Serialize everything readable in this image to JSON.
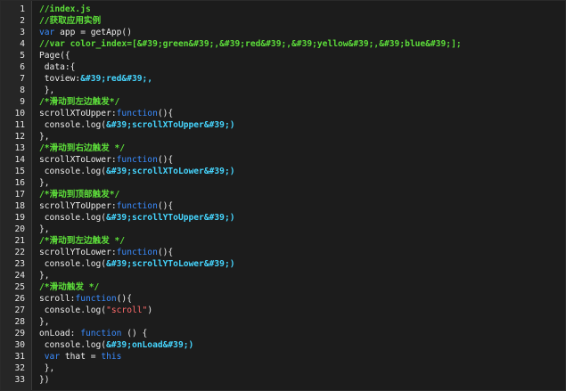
{
  "editor": {
    "lines": [
      {
        "n": "1",
        "segs": [
          {
            "t": "//index.js",
            "k": "cm"
          }
        ]
      },
      {
        "n": "2",
        "segs": [
          {
            "t": "//获取应用实例",
            "k": "cm"
          }
        ]
      },
      {
        "n": "3",
        "segs": [
          {
            "t": "var",
            "k": "kw"
          },
          {
            "t": " app = getApp()",
            "k": "plain"
          }
        ]
      },
      {
        "n": "4",
        "segs": [
          {
            "t": "//var color_index=[&#39;green&#39;,&#39;red&#39;,&#39;yellow&#39;,&#39;blue&#39;];",
            "k": "cm"
          }
        ]
      },
      {
        "n": "5",
        "segs": [
          {
            "t": "Page({",
            "k": "plain"
          }
        ]
      },
      {
        "n": "6",
        "segs": [
          {
            "t": " data:{",
            "k": "plain"
          }
        ]
      },
      {
        "n": "7",
        "segs": [
          {
            "t": " toview:",
            "k": "plain"
          },
          {
            "t": "&#39;red&#39;,",
            "k": "str"
          }
        ]
      },
      {
        "n": "8",
        "segs": [
          {
            "t": " },",
            "k": "plain"
          }
        ]
      },
      {
        "n": "9",
        "segs": [
          {
            "t": "/*滑动到左边触发*/",
            "k": "cm"
          }
        ]
      },
      {
        "n": "10",
        "segs": [
          {
            "t": "scrollXToUpper:",
            "k": "plain"
          },
          {
            "t": "function",
            "k": "kw"
          },
          {
            "t": "(){",
            "k": "plain"
          }
        ]
      },
      {
        "n": "11",
        "segs": [
          {
            "t": " console.log(",
            "k": "plain"
          },
          {
            "t": "&#39;scrollXToUpper&#39;)",
            "k": "str"
          }
        ]
      },
      {
        "n": "12",
        "segs": [
          {
            "t": "},",
            "k": "plain"
          }
        ]
      },
      {
        "n": "13",
        "segs": [
          {
            "t": "/*滑动到右边触发 */",
            "k": "cm"
          }
        ]
      },
      {
        "n": "14",
        "segs": [
          {
            "t": "scrollXToLower:",
            "k": "plain"
          },
          {
            "t": "function",
            "k": "kw"
          },
          {
            "t": "(){",
            "k": "plain"
          }
        ]
      },
      {
        "n": "15",
        "segs": [
          {
            "t": " console.log(",
            "k": "plain"
          },
          {
            "t": "&#39;scrollXToLower&#39;)",
            "k": "str"
          }
        ]
      },
      {
        "n": "16",
        "segs": [
          {
            "t": "},",
            "k": "plain"
          }
        ]
      },
      {
        "n": "17",
        "segs": [
          {
            "t": "/*滑动到顶部触发*/",
            "k": "cm"
          }
        ]
      },
      {
        "n": "18",
        "segs": [
          {
            "t": "scrollYToUpper:",
            "k": "plain"
          },
          {
            "t": "function",
            "k": "kw"
          },
          {
            "t": "(){",
            "k": "plain"
          }
        ]
      },
      {
        "n": "19",
        "segs": [
          {
            "t": " console.log(",
            "k": "plain"
          },
          {
            "t": "&#39;scrollYToUpper&#39;)",
            "k": "str"
          }
        ]
      },
      {
        "n": "20",
        "segs": [
          {
            "t": "},",
            "k": "plain"
          }
        ]
      },
      {
        "n": "21",
        "segs": [
          {
            "t": "/*滑动到左边触发 */",
            "k": "cm"
          }
        ]
      },
      {
        "n": "22",
        "segs": [
          {
            "t": "scrollYToLower:",
            "k": "plain"
          },
          {
            "t": "function",
            "k": "kw"
          },
          {
            "t": "(){",
            "k": "plain"
          }
        ]
      },
      {
        "n": "23",
        "segs": [
          {
            "t": " console.log(",
            "k": "plain"
          },
          {
            "t": "&#39;scrollYToLower&#39;)",
            "k": "str"
          }
        ]
      },
      {
        "n": "24",
        "segs": [
          {
            "t": "},",
            "k": "plain"
          }
        ]
      },
      {
        "n": "25",
        "segs": [
          {
            "t": "/*滑动触发 */",
            "k": "cm"
          }
        ]
      },
      {
        "n": "26",
        "segs": [
          {
            "t": "scroll:",
            "k": "plain"
          },
          {
            "t": "function",
            "k": "kw"
          },
          {
            "t": "(){",
            "k": "plain"
          }
        ]
      },
      {
        "n": "27",
        "segs": [
          {
            "t": " console.log(",
            "k": "plain"
          },
          {
            "t": "\"scroll\"",
            "k": "str2"
          },
          {
            "t": ")",
            "k": "plain"
          }
        ]
      },
      {
        "n": "28",
        "segs": [
          {
            "t": "},",
            "k": "plain"
          }
        ]
      },
      {
        "n": "29",
        "segs": [
          {
            "t": "onLoad: ",
            "k": "plain"
          },
          {
            "t": "function",
            "k": "kw"
          },
          {
            "t": " () {",
            "k": "plain"
          }
        ]
      },
      {
        "n": "30",
        "segs": [
          {
            "t": " console.log(",
            "k": "plain"
          },
          {
            "t": "&#39;onLoad&#39;)",
            "k": "str"
          }
        ]
      },
      {
        "n": "31",
        "segs": [
          {
            "t": " ",
            "k": "plain"
          },
          {
            "t": "var",
            "k": "kw"
          },
          {
            "t": " that = ",
            "k": "plain"
          },
          {
            "t": "this",
            "k": "kw"
          }
        ]
      },
      {
        "n": "32",
        "segs": [
          {
            "t": " },",
            "k": "plain"
          }
        ]
      },
      {
        "n": "33",
        "segs": [
          {
            "t": "})",
            "k": "plain"
          }
        ]
      }
    ]
  },
  "colors": {
    "background": "#1c1c1c",
    "gutter": "#262626",
    "comment": "#5dde3a",
    "keyword": "#3a8cff",
    "string": "#46d6ff",
    "string_alt": "#ff6b6b",
    "text": "#ececec"
  }
}
